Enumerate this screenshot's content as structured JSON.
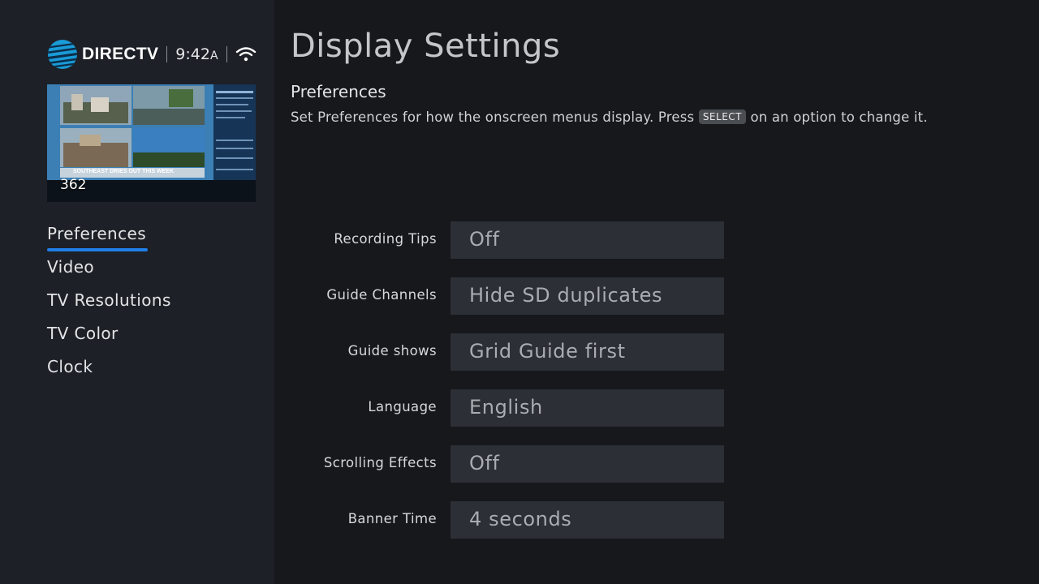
{
  "brand": {
    "name": "DIRECTV",
    "time": "9:42",
    "ampm": "A"
  },
  "preview": {
    "channel": "362",
    "ticker": "SOUTHEAST DRIES OUT THIS WEEK"
  },
  "nav": {
    "items": [
      {
        "label": "Preferences",
        "active": true
      },
      {
        "label": "Video"
      },
      {
        "label": "TV Resolutions"
      },
      {
        "label": "TV Color"
      },
      {
        "label": "Clock"
      }
    ]
  },
  "main": {
    "title": "Display Settings",
    "section_title": "Preferences",
    "description_before": "Set Preferences for how the onscreen menus display. Press",
    "description_key": "SELECT",
    "description_after": "on an option to change it.",
    "settings": [
      {
        "label": "Recording Tips",
        "value": "Off"
      },
      {
        "label": "Guide Channels",
        "value": "Hide SD duplicates"
      },
      {
        "label": "Guide shows",
        "value": "Grid Guide first"
      },
      {
        "label": "Language",
        "value": "English"
      },
      {
        "label": "Scrolling Effects",
        "value": "Off"
      },
      {
        "label": "Banner Time",
        "value": "4 seconds"
      }
    ]
  },
  "colors": {
    "background": "#16181c",
    "sidebar": "#1d2026",
    "accent": "#1f7ee8",
    "field": "#2c2f35"
  }
}
